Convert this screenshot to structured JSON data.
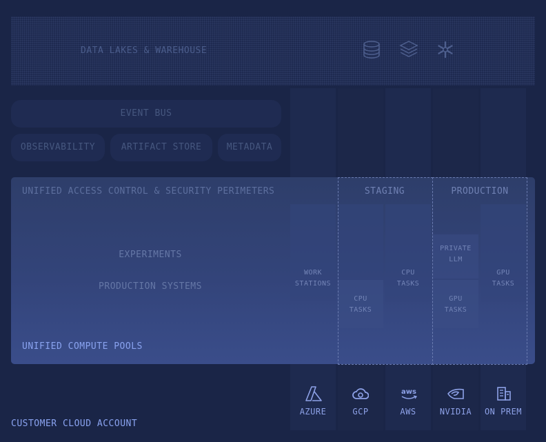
{
  "data_lakes": {
    "label": "DATA LAKES & WAREHOUSE",
    "icons": [
      "database-icon",
      "layers-icon",
      "snowflake-icon"
    ]
  },
  "services": {
    "event_bus": "EVENT BUS",
    "observability": "OBSERVABILITY",
    "artifact_store": "ARTIFACT STORE",
    "metadata": "METADATA"
  },
  "access": {
    "label": "UNIFIED ACCESS CONTROL & SECURITY PERIMETERS",
    "experiments": "EXPERIMENTS",
    "production_systems": "PRODUCTION SYSTEMS",
    "compute_pools": "UNIFIED COMPUTE POOLS"
  },
  "environments": {
    "staging": "STAGING",
    "production": "PRODUCTION"
  },
  "tasks": {
    "workstations": [
      "WORK",
      "STATIONS"
    ],
    "cpu_tasks_gcp": [
      "CPU",
      "TASKS"
    ],
    "cpu_tasks_aws": [
      "CPU",
      "TASKS"
    ],
    "private_llm": [
      "PRIVATE",
      "LLM"
    ],
    "gpu_tasks_nvidia": [
      "GPU",
      "TASKS"
    ],
    "gpu_tasks_onprem": [
      "GPU",
      "TASKS"
    ]
  },
  "vendors": [
    {
      "label": "AZURE",
      "icon": "azure-icon"
    },
    {
      "label": "GCP",
      "icon": "gcp-cloud-icon"
    },
    {
      "label": "AWS",
      "icon": "aws-icon"
    },
    {
      "label": "NVIDIA",
      "icon": "nvidia-icon"
    },
    {
      "label": "ON PREM",
      "icon": "building-icon"
    }
  ],
  "account": {
    "label": "CUSTOMER CLOUD ACCOUNT"
  },
  "colors": {
    "background": "#1a2547",
    "accent": "#8aa3f0",
    "panel": "#33447a"
  }
}
